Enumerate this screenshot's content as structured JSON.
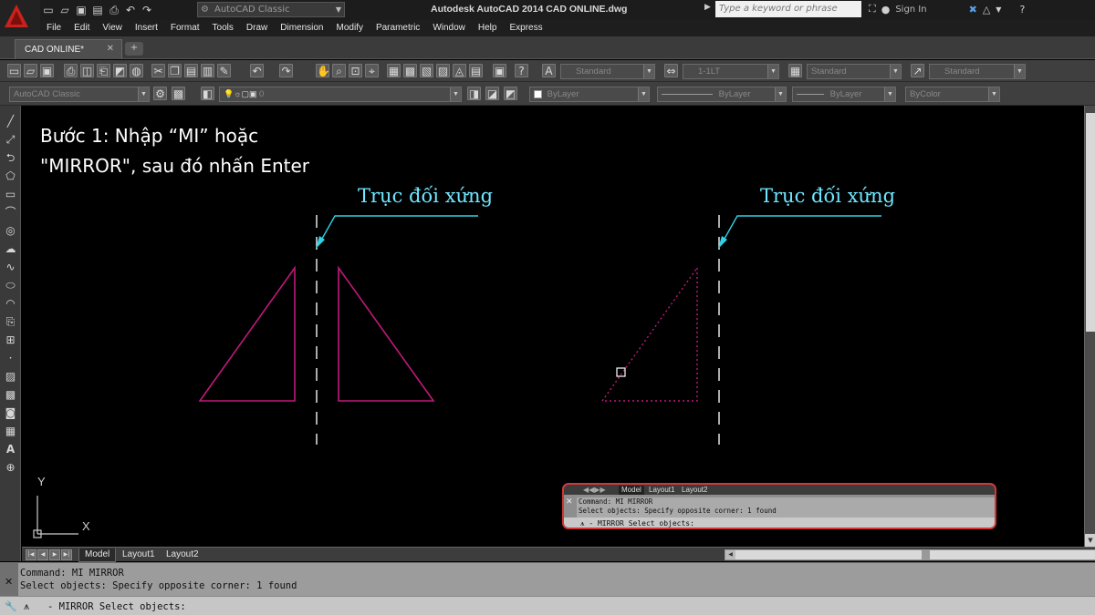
{
  "title_bar": {
    "window_title": "Autodesk AutoCAD 2014    CAD ONLINE.dwg",
    "workspace": "AutoCAD Classic",
    "search_placeholder": "Type a keyword or phrase",
    "sign_in": "Sign In",
    "help_icon": "?"
  },
  "menu": [
    "File",
    "Edit",
    "View",
    "Insert",
    "Format",
    "Tools",
    "Draw",
    "Dimension",
    "Modify",
    "Parametric",
    "Window",
    "Help",
    "Express"
  ],
  "document_tab": {
    "label": "CAD ONLINE*",
    "close": "✕"
  },
  "toolbar_row1": {
    "text_style": "Standard",
    "dim_style": "1-1LT",
    "table_style": "Standard",
    "multileader_style": "Standard"
  },
  "toolbar_row2": {
    "workspace": "AutoCAD Classic",
    "layer": "0",
    "color": "ByLayer",
    "linetype": "ByLayer",
    "lineweight": "ByLayer",
    "plot_style": "ByColor"
  },
  "canvas": {
    "instruction_line1": "Bước 1: Nhập “MI” hoặc",
    "instruction_line2": "\"MIRROR\", sau đó nhấn Enter",
    "axis_label_left": "Trục đối xứng",
    "axis_label_right": "Trục đối xứng",
    "ucs_y": "Y",
    "ucs_x": "X",
    "colors": {
      "triangle": "#c0197a",
      "axis_line": "#e6e6e6",
      "leader": "#2fd3e8"
    }
  },
  "float_command": {
    "tabs": [
      "Model",
      "Layout1",
      "Layout2"
    ],
    "line1": "Command: MI MIRROR",
    "line2": "Select objects: Specify opposite corner: 1 found",
    "input": "- MIRROR Select objects:"
  },
  "layout_tabs": [
    "Model",
    "Layout1",
    "Layout2"
  ],
  "command_line": {
    "history1": "Command: MI MIRROR",
    "history2": "Select objects: Specify opposite corner: 1 found",
    "input": "- MIRROR Select objects:"
  }
}
